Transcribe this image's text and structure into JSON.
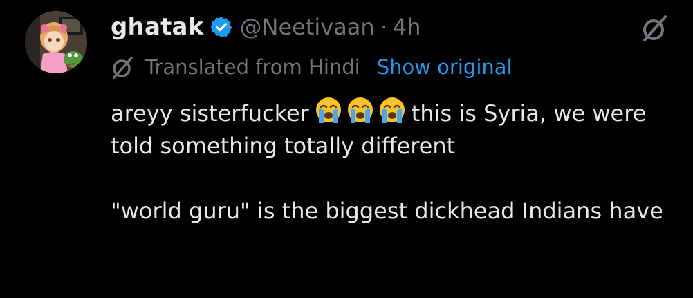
{
  "post": {
    "author": {
      "display_name": "ghatak",
      "handle": "@Neetivaan",
      "separator": "·",
      "time": "4h",
      "verified": true,
      "avatar_icon": "avatar-anime-girl-with-frog"
    },
    "grok_icon": "grok-icon",
    "translation": {
      "label": "Translated from Hindi",
      "show_original": "Show original"
    },
    "body": {
      "line1_before": "areyy sisterfucker",
      "emoji_name": "loudly-crying-face-emoji",
      "emoji_count": 3,
      "line1_after": "this is Syria, we were told something totally different",
      "paragraph2": "\"world guru\" is the biggest dickhead Indians have"
    }
  },
  "colors": {
    "background": "#000000",
    "text_primary": "#e7e9ea",
    "text_secondary": "#71767b",
    "link": "#1d9bf0",
    "verified_badge": "#1d9bf0"
  }
}
